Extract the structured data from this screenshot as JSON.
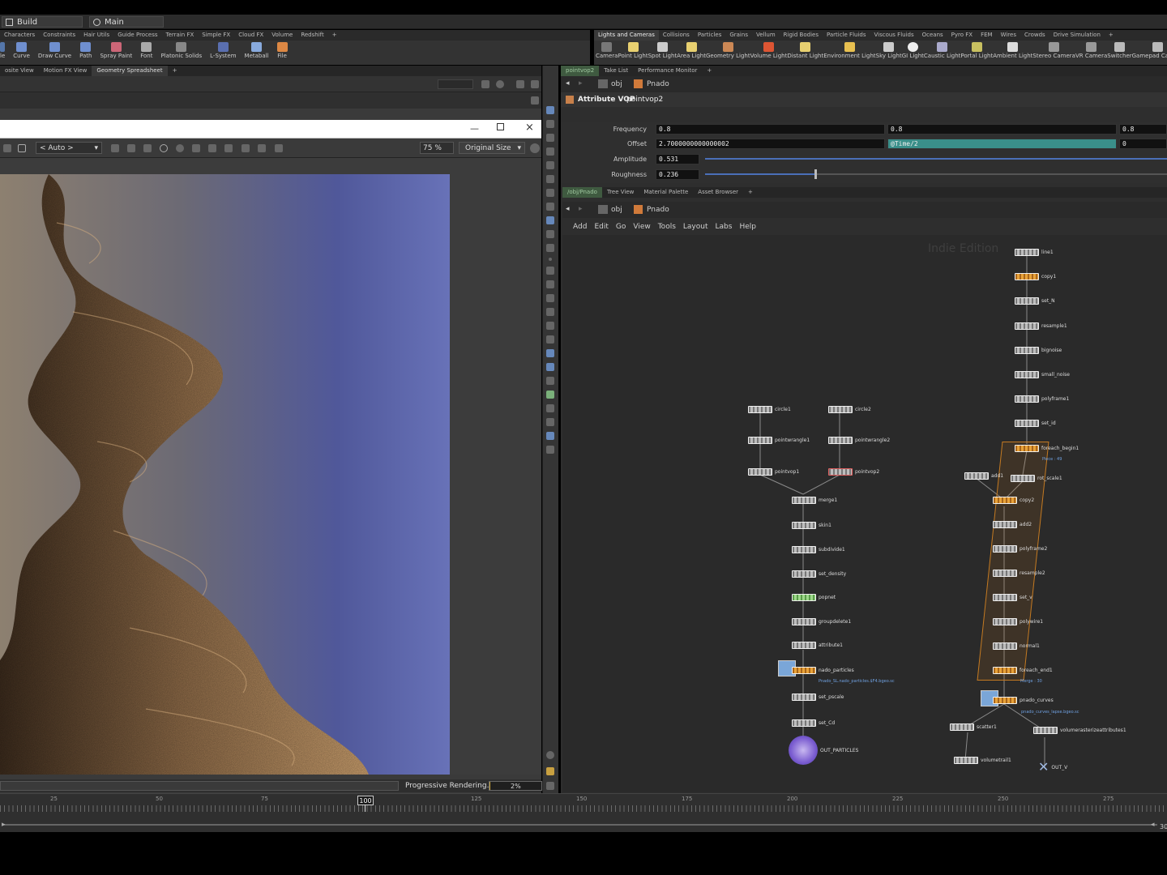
{
  "menubar": {
    "desktop": "Build",
    "context": "Main"
  },
  "shelf_left": {
    "tabs": [
      "Characters",
      "Constraints",
      "Hair Utils",
      "Guide Process",
      "Terrain FX",
      "Simple FX",
      "Cloud FX",
      "Volume",
      "Redshift"
    ],
    "tools": [
      "le",
      "Curve",
      "Draw Curve",
      "Path",
      "Spray Paint",
      "Font",
      "Platonic Solids",
      "L-System",
      "Metaball",
      "File"
    ]
  },
  "shelf_right": {
    "tabs": [
      "Lights and Cameras",
      "Collisions",
      "Particles",
      "Grains",
      "Vellum",
      "Rigid Bodies",
      "Particle Fluids",
      "Viscous Fluids",
      "Oceans",
      "Pyro FX",
      "FEM",
      "Wires",
      "Crowds",
      "Drive Simulation"
    ],
    "tools": [
      "Camera",
      "Point Light",
      "Spot Light",
      "Area Light",
      "Geometry Light",
      "Volume Light",
      "Distant Light",
      "Environment Light",
      "Sky Light",
      "GI Light",
      "Caustic Light",
      "Portal Light",
      "Ambient Light",
      "Stereo Camera",
      "VR Camera",
      "Switcher",
      "Gamepad Camera"
    ]
  },
  "left_tabs": [
    "osite View",
    "Motion FX View",
    "Geometry Spreadsheet"
  ],
  "render": {
    "camera": "< Auto >",
    "zoom": "75 %",
    "size": "Original Size",
    "status": "Progressive Rendering...",
    "progress_text": "2%",
    "progress": 0.02
  },
  "right_top_tabs": [
    "pointvop2",
    "Take List",
    "Performance Monitor"
  ],
  "path": {
    "root": "obj",
    "node": "Pnado"
  },
  "param_header": {
    "type": "Attribute VOP",
    "name": "pointvop2"
  },
  "params": {
    "frequency_label": "Frequency",
    "frequency": [
      "0.8",
      "0.8",
      "0.8"
    ],
    "offset_label": "Offset",
    "offset": [
      "2.7000000000000002",
      "@Time/2",
      "0"
    ],
    "amplitude_label": "Amplitude",
    "amplitude": "0.531",
    "roughness_label": "Roughness",
    "roughness": "0.236"
  },
  "net_tabs": [
    "/obj/Pnado",
    "Tree View",
    "Material Palette",
    "Asset Browser"
  ],
  "net_menu": [
    "Add",
    "Edit",
    "Go",
    "View",
    "Tools",
    "Layout",
    "Labs",
    "Help"
  ],
  "watermark": "Indie Edition",
  "nodes": {
    "line1": "line1",
    "copy1": "copy1",
    "set_N": "set_N",
    "resample1": "resample1",
    "bignoise": "bignoise",
    "small_noise": "small_noise",
    "polyframe1": "polyframe1",
    "set_id": "set_id",
    "foreach_begin1": "foreach_begin1",
    "piece": "Piece : 49",
    "add1": "add1",
    "rot_scale1": "rot_scale1",
    "copy2": "copy2",
    "add2": "add2",
    "polyframe2": "polyframe2",
    "resample2": "resample2",
    "set_v": "set_v",
    "polywire1": "polywire1",
    "normal1": "normal1",
    "foreach_end1": "foreach_end1",
    "merge30": "Merge : 30",
    "pnado_curves": "pnado_curves",
    "pnado_curves_file": "pnado_curves_lapse.bgeo.sc",
    "scatter1": "scatter1",
    "volumerasterize": "volumerasterizeattributes1",
    "volumetrail1": "volumetrail1",
    "OUT_V": "OUT_V",
    "circle1": "circle1",
    "circle2": "circle2",
    "pointwrangle1": "pointwrangle1",
    "pointwrangle2": "pointwrangle2",
    "pointvop1": "pointvop1",
    "pointvop2": "pointvop2",
    "merge1": "merge1",
    "skin1": "skin1",
    "subdivide1": "subdivide1",
    "set_density": "set_density",
    "popnet": "popnet",
    "groupdelete1": "groupdelete1",
    "attribute1": "attribute1",
    "nado_particles": "nado_particles",
    "nado_file": "Pnado_SL.nado_particles.$F4.bgeo.sc",
    "set_pscale": "set_pscale",
    "set_Cd": "set_Cd",
    "OUT_PARTICLES": "OUT_PARTICLES"
  },
  "timeline": {
    "current_frame": "100",
    "labels": [
      "25",
      "50",
      "75",
      "125",
      "150",
      "175",
      "200",
      "225",
      "250",
      "275"
    ],
    "end_frame": "30"
  }
}
